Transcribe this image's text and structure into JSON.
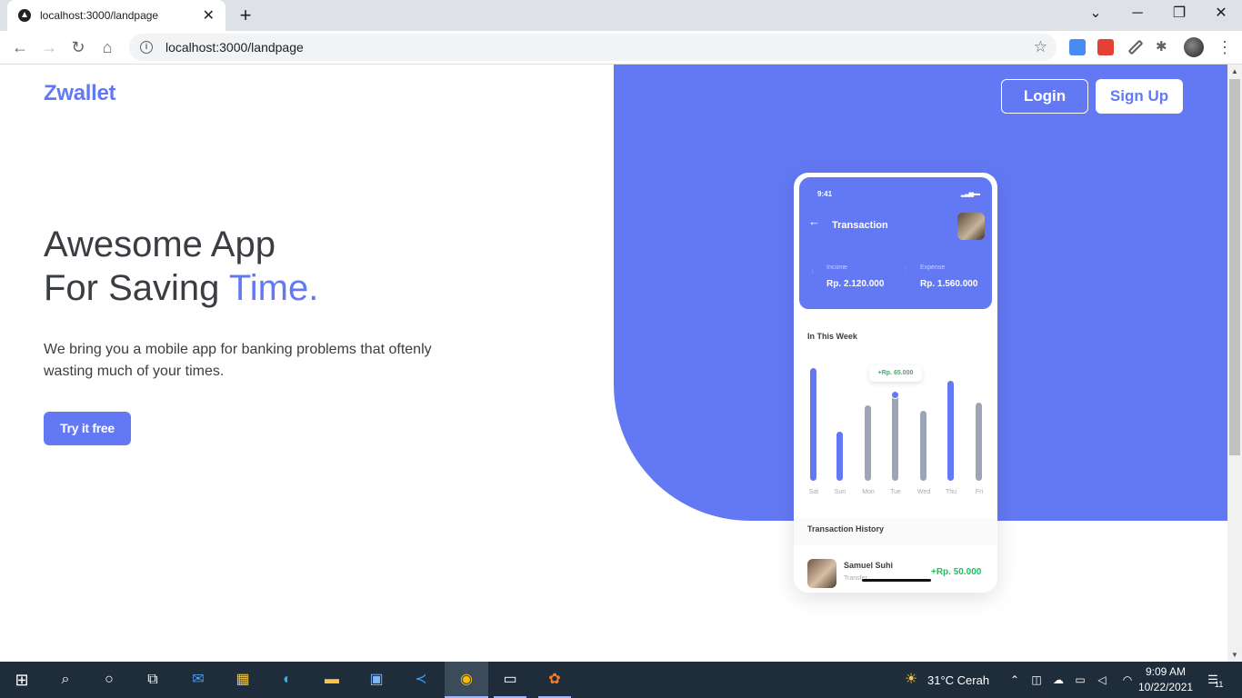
{
  "browser": {
    "tab_title": "localhost:3000/landpage",
    "url": "localhost:3000/landpage",
    "new_tab": "+",
    "close_tab": "✕",
    "window_buttons": [
      "⌄",
      "─",
      "❐",
      "✕"
    ]
  },
  "nav": {
    "logo": "Zwallet",
    "login_label": "Login",
    "signup_label": "Sign Up"
  },
  "hero": {
    "headline_line1": "Awesome App",
    "headline_line2_prefix": "For Saving ",
    "headline_line2_accent": "Time.",
    "description": "We bring you a mobile app for banking problems that oftenly wasting much of your times.",
    "cta_label": "Try it free"
  },
  "phone": {
    "status_time": "9:41",
    "header_title": "Transaction",
    "income_label": "Income",
    "income_amount": "Rp. 2.120.000",
    "expense_label": "Expense",
    "expense_amount": "Rp. 1.560.000",
    "week_title": "In This Week",
    "tooltip": "+Rp. 65.000",
    "days": [
      "Sat",
      "Sun",
      "Mon",
      "Tue",
      "Wed",
      "Thu",
      "Fri"
    ],
    "history_title": "Transaction History",
    "history": [
      {
        "name": "Samuel Suhi",
        "type": "Transfer",
        "amount": "+Rp. 50.000"
      }
    ]
  },
  "colors": {
    "primary": "#6379f4",
    "income": "#1ec15f",
    "expense": "#ff5b6b",
    "inactive_bar": "#9da6b5"
  },
  "taskbar": {
    "weather": "31°C  Cerah",
    "time": "9:09 AM",
    "date": "10/22/2021",
    "notifications": "11"
  }
}
